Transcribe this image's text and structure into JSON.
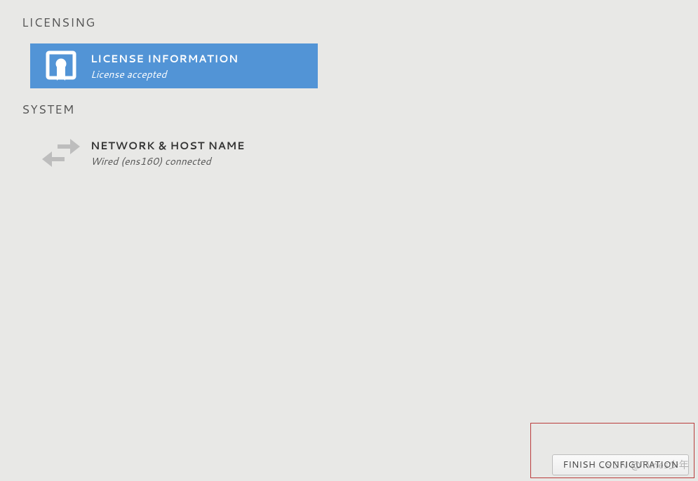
{
  "sections": {
    "licensing": {
      "header": "LICENSING",
      "spoke": {
        "title": "LICENSE INFORMATION",
        "status": "License accepted",
        "icon_name": "license-certificate-icon"
      }
    },
    "system": {
      "header": "SYSTEM",
      "spoke": {
        "title": "NETWORK & HOST NAME",
        "status": "Wired (ens160) connected",
        "icon_name": "network-arrows-icon"
      }
    }
  },
  "footer": {
    "finish_label": "FINISH CONFIGURATION"
  },
  "watermark": "CSDN @Times少年"
}
